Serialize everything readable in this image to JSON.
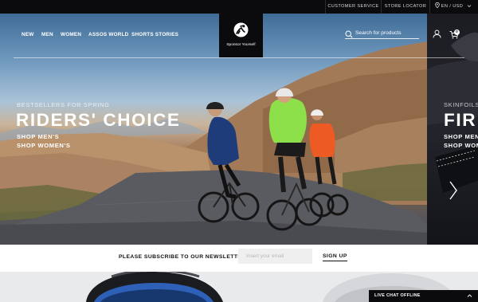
{
  "utility": {
    "customer_service": "CUSTOMER SERVICE",
    "store_locator": "STORE LOCATOR",
    "language_currency": "EN / USD",
    "icons": [
      "location-pin-icon",
      "chevron-down-icon"
    ]
  },
  "nav": {
    "items": [
      {
        "label": "NEW"
      },
      {
        "label": "MEN"
      },
      {
        "label": "WOMEN"
      },
      {
        "label": "ASSOS WORLD"
      },
      {
        "label": "SHORTS STORIES"
      }
    ]
  },
  "logo": {
    "tagline": "Sponsor Yourself",
    "icon": "assos-logo-icon"
  },
  "header": {
    "search_placeholder": "Search for products",
    "cart_count": "0",
    "icons": [
      "search-icon",
      "account-icon",
      "cart-icon"
    ]
  },
  "hero": {
    "kicker": "BESTSELLERS FOR SPRING",
    "title": "RIDERS' CHOICE",
    "links": [
      "SHOP MEN'S",
      "SHOP WOMEN'S"
    ]
  },
  "next_slide": {
    "kicker": "SKINFOILS",
    "title": "FIR",
    "links": [
      "SHOP MEN'S",
      "SHOP WOMEN'S"
    ],
    "icon": "chevron-right-icon"
  },
  "newsletter": {
    "label": "PLEASE SUBSCRIBE TO OUR NEWSLETTER",
    "placeholder": "Insert your email",
    "button": "SIGN UP"
  },
  "live_chat": {
    "label": "LIVE CHAT OFFLINE",
    "icon": "chevron-up-icon"
  },
  "colors": {
    "bar": "#0b0b0d",
    "text_light": "#ffffff",
    "jersey_navy": "#1e3c7a",
    "jersey_lime": "#8ee04a",
    "jersey_orange": "#ee5a24"
  }
}
